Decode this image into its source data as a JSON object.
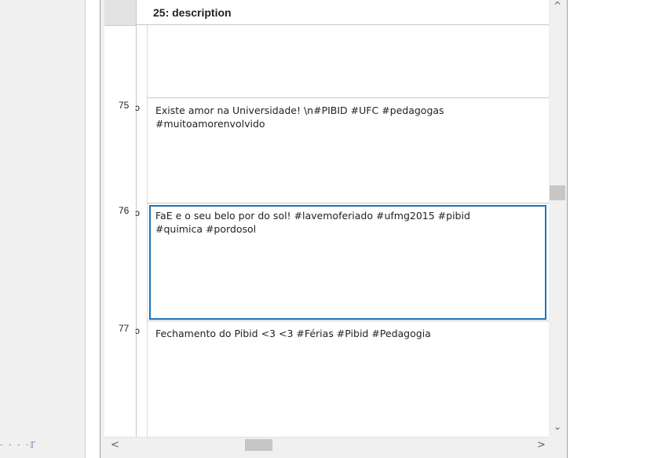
{
  "grid": {
    "column_header": "25: description",
    "rows": [
      {
        "number": "75",
        "tick": "ɔ",
        "text": "Existe amor na Universidade! \\n#PIBID #UFC #pedagogas\n#muitoamorenvolvido"
      },
      {
        "number": "76",
        "tick": "ɔ",
        "text": "FaE e o seu belo por do sol! #lavemoferiado #ufmg2015 #pibid\n#quimica #pordosol"
      },
      {
        "number": "77",
        "tick": "ɔ",
        "text": "Fechamento do Pibid <3 <3 #Férias #Pibid #Pedagogia"
      }
    ],
    "selected_row": "76"
  },
  "scrollbars": {
    "up_arrow": "^",
    "down_arrow": "⌄",
    "left_arrow": "<",
    "right_arrow": ">"
  },
  "left_panel": {
    "glyph": "· · · ·ℾ"
  },
  "colors": {
    "focus_border": "#1e73b8",
    "grid_lines": "#c8c8c8",
    "scroll_thumb": "#c6c6c6"
  }
}
